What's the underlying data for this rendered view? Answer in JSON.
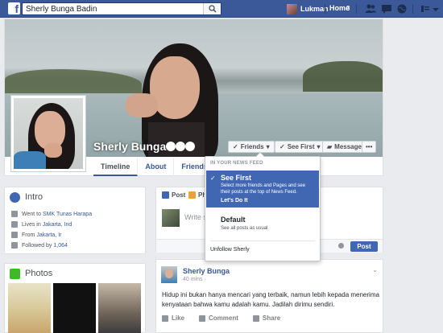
{
  "topbar": {
    "logo": "f",
    "search_value": "Sherly Bunga Badin",
    "user_name": "Lukman",
    "home_label": "Home",
    "home_count": "3"
  },
  "profile": {
    "name": "Sherly Bunga",
    "buttons": {
      "friends": "Friends",
      "see_first": "See First",
      "message": "Message",
      "more": "•••"
    },
    "tabs": [
      "Timeline",
      "About",
      "Friends"
    ]
  },
  "intro": {
    "title": "Intro",
    "rows": [
      {
        "prefix": "Went to",
        "link": "SMK Tunas Harapa"
      },
      {
        "prefix": "Lives in",
        "link": "Jakarta, Ind"
      },
      {
        "prefix": "From",
        "link": "Jakarta, Ir"
      },
      {
        "prefix": "Followed by",
        "link": "1,064"
      }
    ]
  },
  "photos": {
    "title": "Photos"
  },
  "composer": {
    "tab_post": "Post",
    "tab_photo": "Ph",
    "placeholder": "Write so",
    "post_button": "Post"
  },
  "post": {
    "author": "Sherly Bunga",
    "time": "40 mins ·",
    "text": "Hidup ini bukan hanya mencari yang terbaik, namun lebih kepada menerima kenyataan bahwa kamu adalah kamu. Jadilah dirimu sendiri.",
    "actions": [
      "Like",
      "Comment",
      "Share"
    ]
  },
  "dropdown": {
    "header": "IN YOUR NEWS FEED",
    "selected": {
      "title": "See First",
      "description": "Select more friends and Pages and see their posts at the top of News Feed.",
      "link": "Let's Do It"
    },
    "default": {
      "title": "Default",
      "description": "See all posts as usual"
    },
    "unfollow": "Unfollow Sherly"
  },
  "colors": {
    "brand": "#3b5998",
    "accent": "#4267b2",
    "link": "#365899"
  }
}
